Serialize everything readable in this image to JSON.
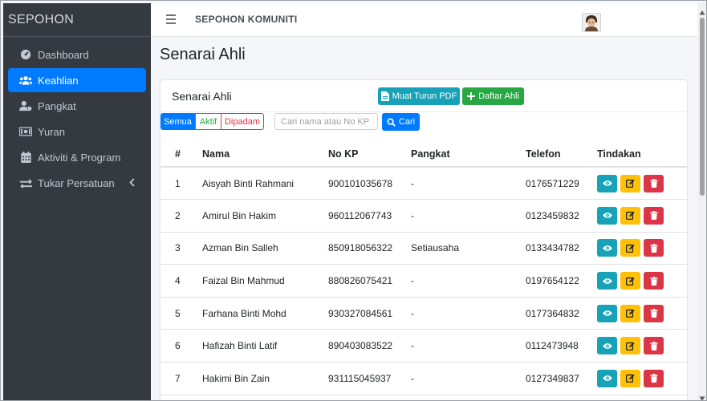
{
  "sidebar": {
    "brand": "SEPOHON",
    "items": [
      {
        "label": "Dashboard",
        "icon": "tachometer-icon"
      },
      {
        "label": "Keahlian",
        "icon": "users-icon"
      },
      {
        "label": "Pangkat",
        "icon": "user-tag-icon"
      },
      {
        "label": "Yuran",
        "icon": "money-icon"
      },
      {
        "label": "Aktiviti & Program",
        "icon": "calendar-icon"
      },
      {
        "label": "Tukar Persatuan",
        "icon": "exchange-icon"
      }
    ],
    "active_index": 1
  },
  "topbar": {
    "title": "SEPOHON KOMUNITI"
  },
  "page": {
    "title": "Senarai Ahli"
  },
  "card": {
    "title": "Senarai Ahli",
    "pdf_label": "Muat Turun PDF",
    "add_label": "Daftar Ahli"
  },
  "filters": {
    "all": "Semua",
    "active": "Aktif",
    "inactive": "Dipadam",
    "selected": "Semua"
  },
  "search": {
    "placeholder": "Cari nama atau No KP",
    "value": "",
    "button": "Cari"
  },
  "table": {
    "headers": [
      "#",
      "Nama",
      "No KP",
      "Pangkat",
      "Telefon",
      "Tindakan"
    ],
    "rows": [
      {
        "no": "1",
        "name": "Aisyah Binti Rahmani",
        "kp": "900101035678",
        "rank": "-",
        "phone": "0176571229"
      },
      {
        "no": "2",
        "name": "Amirul Bin Hakim",
        "kp": "960112067743",
        "rank": "-",
        "phone": "0123459832"
      },
      {
        "no": "3",
        "name": "Azman Bin Salleh",
        "kp": "850918056322",
        "rank": "Setiausaha",
        "phone": "0133434782"
      },
      {
        "no": "4",
        "name": "Faizal Bin Mahmud",
        "kp": "880826075421",
        "rank": "-",
        "phone": "0197654122"
      },
      {
        "no": "5",
        "name": "Farhana Binti Mohd",
        "kp": "930327084561",
        "rank": "-",
        "phone": "0177364832"
      },
      {
        "no": "6",
        "name": "Hafizah Binti Latif",
        "kp": "890403083522",
        "rank": "-",
        "phone": "0112473948"
      },
      {
        "no": "7",
        "name": "Hakimi Bin Zain",
        "kp": "931115045937",
        "rank": "-",
        "phone": "0127349837"
      }
    ]
  },
  "colors": {
    "sidebar_bg": "#343a40",
    "primary": "#007bff",
    "info": "#17a2b8",
    "success": "#28a745",
    "warning": "#ffc107",
    "danger": "#dc3545"
  }
}
